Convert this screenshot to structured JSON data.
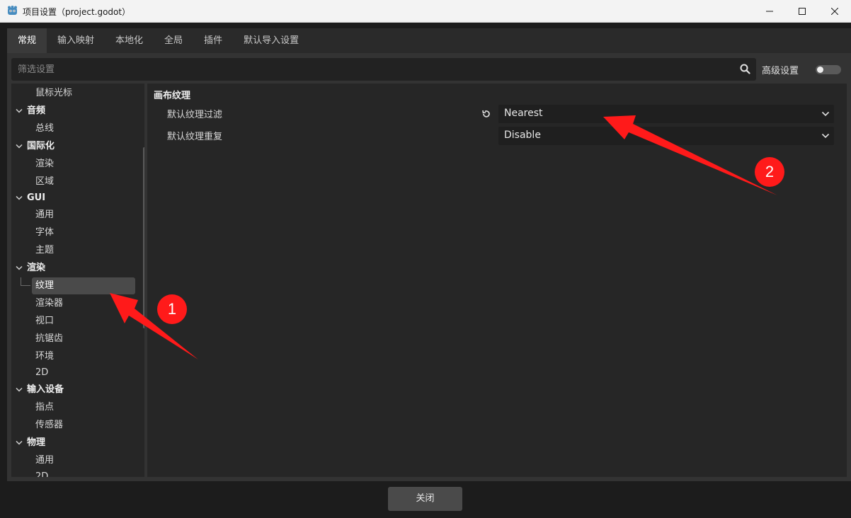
{
  "window": {
    "title": "项目设置（project.godot）",
    "app_icon": "godot-icon"
  },
  "tabs": [
    {
      "label": "常规",
      "active": true
    },
    {
      "label": "输入映射",
      "active": false
    },
    {
      "label": "本地化",
      "active": false
    },
    {
      "label": "全局",
      "active": false
    },
    {
      "label": "插件",
      "active": false
    },
    {
      "label": "默认导入设置",
      "active": false
    }
  ],
  "search": {
    "placeholder": "筛选设置",
    "icon": "search-icon"
  },
  "advanced": {
    "label": "高级设置",
    "enabled": false
  },
  "tree": {
    "items": [
      {
        "label": "鼠标光标",
        "kind": "sub"
      },
      {
        "label": "音频",
        "kind": "section"
      },
      {
        "label": "总线",
        "kind": "sub"
      },
      {
        "label": "国际化",
        "kind": "section"
      },
      {
        "label": "渲染",
        "kind": "sub"
      },
      {
        "label": "区域",
        "kind": "sub"
      },
      {
        "label": "GUI",
        "kind": "section"
      },
      {
        "label": "通用",
        "kind": "sub"
      },
      {
        "label": "字体",
        "kind": "sub"
      },
      {
        "label": "主题",
        "kind": "sub"
      },
      {
        "label": "渲染",
        "kind": "section"
      },
      {
        "label": "纹理",
        "kind": "sub",
        "selected": true
      },
      {
        "label": "渲染器",
        "kind": "sub"
      },
      {
        "label": "视口",
        "kind": "sub"
      },
      {
        "label": "抗锯齿",
        "kind": "sub"
      },
      {
        "label": "环境",
        "kind": "sub"
      },
      {
        "label": "2D",
        "kind": "sub"
      },
      {
        "label": "输入设备",
        "kind": "section"
      },
      {
        "label": "指点",
        "kind": "sub"
      },
      {
        "label": "传感器",
        "kind": "sub"
      },
      {
        "label": "物理",
        "kind": "section"
      },
      {
        "label": "通用",
        "kind": "sub"
      },
      {
        "label": "2D",
        "kind": "sub"
      }
    ]
  },
  "content": {
    "section_title": "画布纹理",
    "properties": [
      {
        "label": "默认纹理过滤",
        "value": "Nearest",
        "revert_icon": "revert-icon"
      },
      {
        "label": "默认纹理重复",
        "value": "Disable"
      }
    ]
  },
  "footer": {
    "close_label": "关闭"
  },
  "annotations": {
    "color": "#ff1a1a",
    "badges": [
      "1",
      "2"
    ]
  },
  "colors": {
    "background": "#1c1c1c",
    "panel": "#333333",
    "selected": "#4a4a4a",
    "annotation": "#ff1a1a"
  }
}
